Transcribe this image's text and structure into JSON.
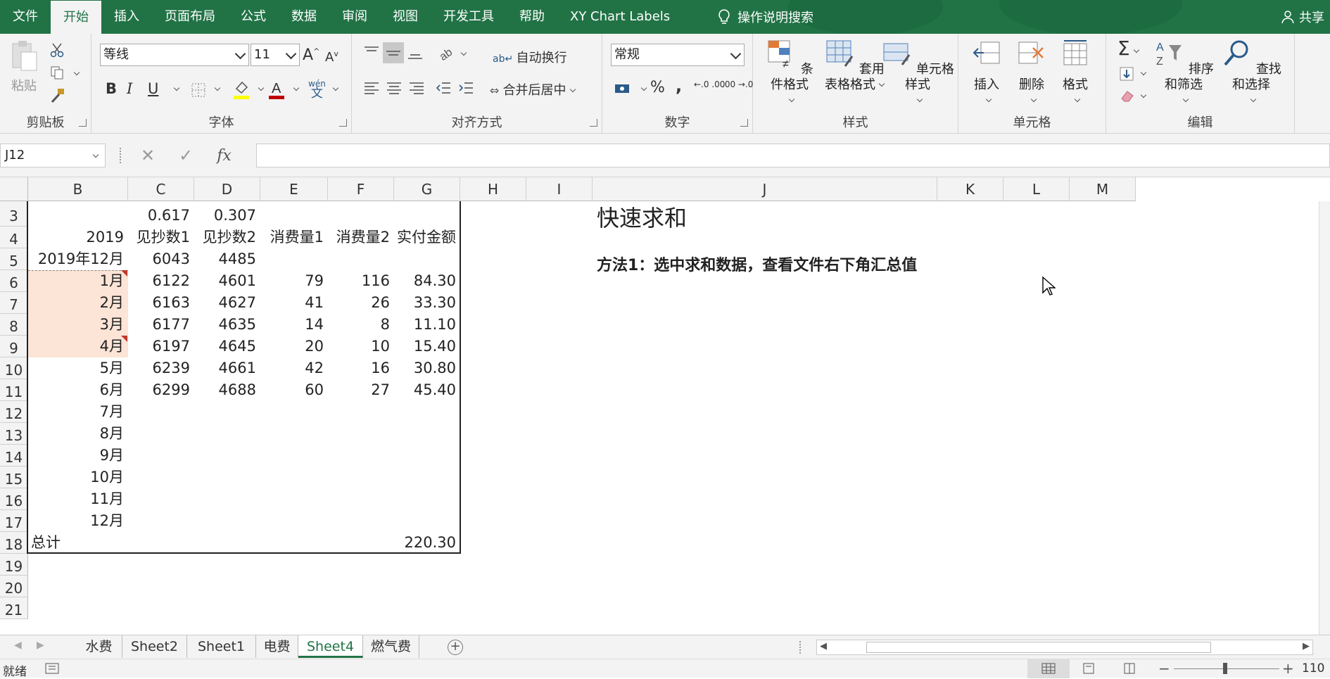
{
  "menu": {
    "tabs": [
      "文件",
      "开始",
      "插入",
      "页面布局",
      "公式",
      "数据",
      "审阅",
      "视图",
      "开发工具",
      "帮助",
      "XY Chart Labels"
    ],
    "active": "开始",
    "tellme": "操作说明搜索",
    "share": "共享"
  },
  "ribbon": {
    "clipboard": {
      "paste": "粘贴",
      "label": "剪贴板"
    },
    "font": {
      "name": "等线",
      "size": "11",
      "label": "字体",
      "grow": "A",
      "shrink": "A",
      "bold": "B",
      "italic": "I",
      "underline": "U",
      "phonetic_top": "wén",
      "phonetic_bottom": "文"
    },
    "alignment": {
      "wrap": "自动换行",
      "merge": "合并后居中",
      "label": "对齐方式"
    },
    "number": {
      "format": "常规",
      "label": "数字",
      "percent": "%",
      "comma": ",",
      "inc_decimal": "←.0 .00",
      "dec_decimal": ".00 →.0"
    },
    "styles": {
      "conditional": "条件格式",
      "table_line1": "套用",
      "table_line2": "表格格式",
      "cell_styles": "单元格样式",
      "label": "样式"
    },
    "cells": {
      "insert": "插入",
      "delete": "删除",
      "format": "格式",
      "label": "单元格"
    },
    "editing": {
      "sort": "排序和筛选",
      "find": "查找和选择",
      "label": "编辑",
      "sigma": "Σ"
    }
  },
  "formula_bar": {
    "name_box": "J12",
    "fx": "fx",
    "value": ""
  },
  "columns": [
    "B",
    "C",
    "D",
    "E",
    "F",
    "G",
    "H",
    "I",
    "J",
    "K",
    "L",
    "M"
  ],
  "rows": [
    "3",
    "4",
    "5",
    "6",
    "7",
    "8",
    "9",
    "10",
    "11",
    "12",
    "13",
    "14",
    "15",
    "16",
    "17",
    "18",
    "19",
    "20",
    "21"
  ],
  "cells": {
    "r3": {
      "C": "0.617",
      "D": "0.307"
    },
    "r4": {
      "B": "2019",
      "C": "见抄数1",
      "D": "见抄数2",
      "E": "消费量1",
      "F": "消费量2",
      "G": "实付金额"
    },
    "r5": {
      "B": "2019年12月",
      "C": "6043",
      "D": "4485"
    },
    "data_rows": [
      {
        "B": "1月",
        "C": "6122",
        "D": "4601",
        "E": "79",
        "F": "116",
        "G": "84.30"
      },
      {
        "B": "2月",
        "C": "6163",
        "D": "4627",
        "E": "41",
        "F": "26",
        "G": "33.30"
      },
      {
        "B": "3月",
        "C": "6177",
        "D": "4635",
        "E": "14",
        "F": "8",
        "G": "11.10"
      },
      {
        "B": "4月",
        "C": "6197",
        "D": "4645",
        "E": "20",
        "F": "10",
        "G": "15.40"
      },
      {
        "B": "5月",
        "C": "6239",
        "D": "4661",
        "E": "42",
        "F": "16",
        "G": "30.80"
      },
      {
        "B": "6月",
        "C": "6299",
        "D": "4688",
        "E": "60",
        "F": "27",
        "G": "45.40"
      }
    ],
    "empty_months": [
      "7月",
      "8月",
      "9月",
      "10月",
      "11月",
      "12月"
    ],
    "total": {
      "B": "总计",
      "G": "220.30"
    },
    "title": "快速求和",
    "method": "方法1：选中求和数据，查看文件右下角汇总值"
  },
  "sheets": [
    "水费",
    "Sheet2",
    "Sheet1",
    "电费",
    "Sheet4",
    "燃气费"
  ],
  "active_sheet": "Sheet4",
  "status": {
    "ready": "就绪",
    "zoom": "110"
  },
  "colors": {
    "excel_green": "#217346",
    "highlight": "#fce4d6"
  }
}
